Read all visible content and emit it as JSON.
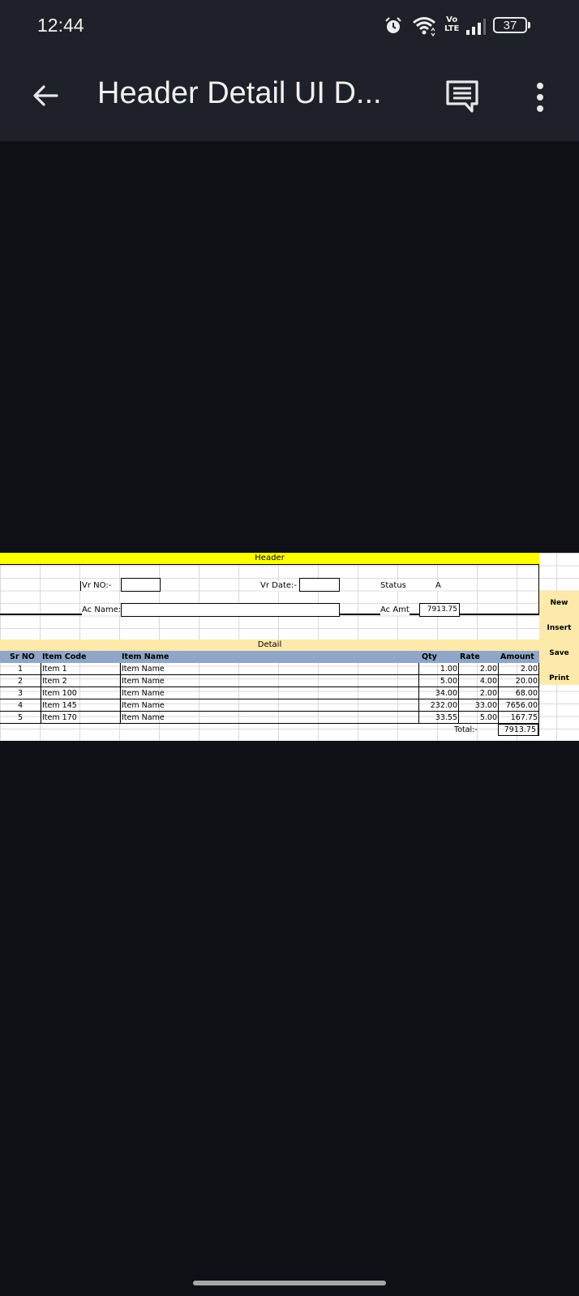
{
  "status_bar": {
    "time": "12:44",
    "volte_top": "Vo",
    "volte_bottom": "LTE",
    "battery": "37"
  },
  "app_bar": {
    "title": "Header Detail UI D..."
  },
  "sheet": {
    "header_title": "Header",
    "vr_no_label": "Vr NO:-",
    "vr_date_label": "Vr Date:-",
    "status_label": "Status",
    "status_value": "A",
    "ac_name_label": "Ac Name:",
    "ac_amt_label": "Ac Amt",
    "ac_amt_value": "7913.75",
    "buttons": [
      "New",
      "Insert",
      "Save",
      "Print"
    ],
    "detail_title": "Detail",
    "columns": {
      "sr": "Sr NO",
      "code": "Item Code",
      "name": "Item Name",
      "qty": "Qty",
      "rate": "Rate",
      "amount": "Amount"
    },
    "rows": [
      {
        "sr": "1",
        "code": "Item 1",
        "name": "Item Name",
        "qty": "1.00",
        "rate": "2.00",
        "amount": "2.00"
      },
      {
        "sr": "2",
        "code": "Item 2",
        "name": "Item Name",
        "qty": "5.00",
        "rate": "4.00",
        "amount": "20.00"
      },
      {
        "sr": "3",
        "code": "Item 100",
        "name": "Item Name",
        "qty": "34.00",
        "rate": "2.00",
        "amount": "68.00"
      },
      {
        "sr": "4",
        "code": "Item 145",
        "name": "Item Name",
        "qty": "232.00",
        "rate": "33.00",
        "amount": "7656.00"
      },
      {
        "sr": "5",
        "code": "Item 170",
        "name": "Item Name",
        "qty": "33.55",
        "rate": "5.00",
        "amount": "167.75"
      }
    ],
    "total_label": "Total:-",
    "total_value": "7913.75"
  },
  "colors": {
    "status_bar_bg": "#1e2129",
    "page_bg": "#0f1117",
    "header_band": "#ffff00",
    "detail_band": "#fde9a9",
    "column_header": "#8fa6c8"
  },
  "icons": [
    "back-arrow-icon",
    "comment-icon",
    "more-vert-icon",
    "alarm-icon",
    "wifi-icon",
    "signal-icon",
    "battery-icon"
  ]
}
